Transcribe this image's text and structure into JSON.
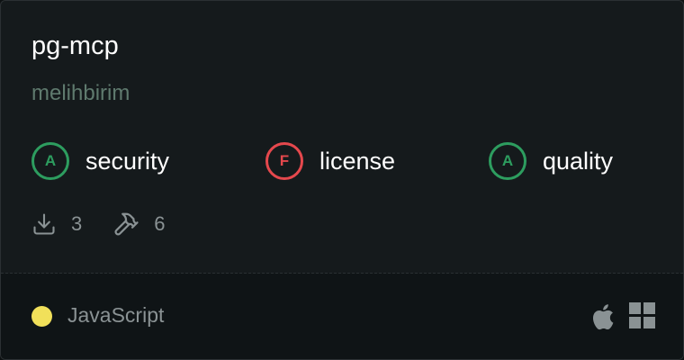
{
  "card": {
    "title": "pg-mcp",
    "owner": "melihbirim"
  },
  "grades": [
    {
      "grade": "A",
      "label": "security",
      "status": "pass"
    },
    {
      "grade": "F",
      "label": "license",
      "status": "fail"
    },
    {
      "grade": "A",
      "label": "quality",
      "status": "pass"
    }
  ],
  "stats": {
    "downloads": "3",
    "tools": "6"
  },
  "footer": {
    "language": "JavaScript",
    "language_color": "#f1e05a",
    "platforms": [
      "apple-icon",
      "windows-icon"
    ]
  },
  "colors": {
    "pass": "#2d9d5f",
    "fail": "#e5484d"
  }
}
